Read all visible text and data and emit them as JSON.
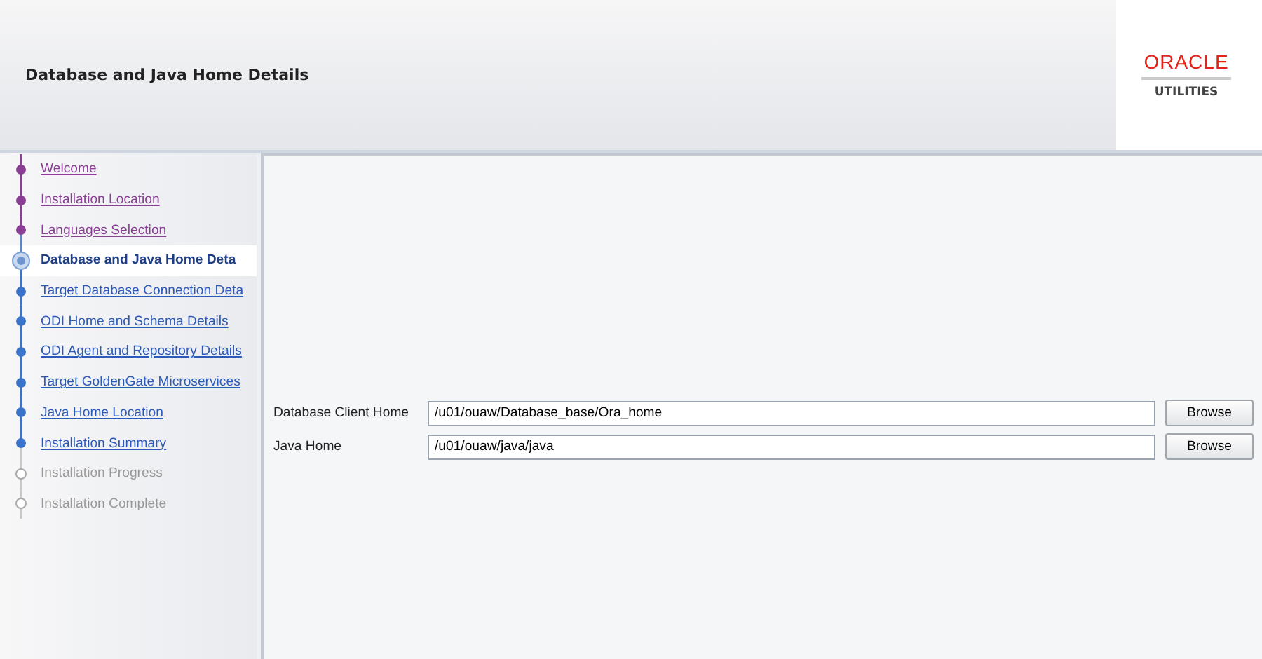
{
  "header": {
    "title": "Database and Java Home Details",
    "logo": {
      "brand": "ORACLE",
      "product": "UTILITIES"
    }
  },
  "steps": [
    {
      "label": "Welcome",
      "kind": "done",
      "selected": false
    },
    {
      "label": "Installation Location",
      "kind": "done",
      "selected": false
    },
    {
      "label": "Languages Selection",
      "kind": "done",
      "selected": false
    },
    {
      "label": "Database and Java Home Deta",
      "kind": "current",
      "selected": true
    },
    {
      "label": "Target Database Connection Deta",
      "kind": "pending",
      "selected": false
    },
    {
      "label": "ODI Home and Schema Details",
      "kind": "pending",
      "selected": false
    },
    {
      "label": "ODI Agent and Repository Details",
      "kind": "pending",
      "selected": false
    },
    {
      "label": "Target GoldenGate Microservices",
      "kind": "pending",
      "selected": false
    },
    {
      "label": "Java Home Location",
      "kind": "pending",
      "selected": false
    },
    {
      "label": "Installation Summary",
      "kind": "pending",
      "selected": false
    },
    {
      "label": "Installation Progress",
      "kind": "inactive",
      "selected": false
    },
    {
      "label": "Installation Complete",
      "kind": "inactive",
      "selected": false
    }
  ],
  "fields": [
    {
      "label": "Database Client Home",
      "value": "/u01/ouaw/Database_base/Ora_home",
      "button": "Browse"
    },
    {
      "label": "Java Home",
      "value": "/u01/ouaw/java/java",
      "button": "Browse"
    }
  ]
}
